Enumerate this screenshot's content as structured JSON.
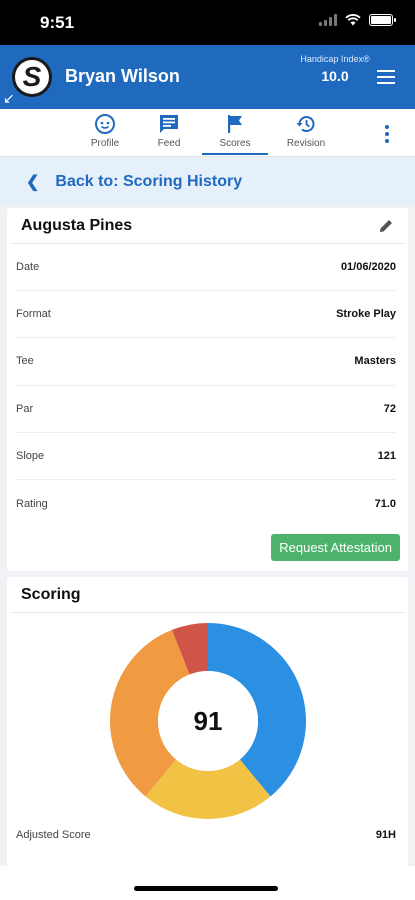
{
  "status": {
    "time": "9:51"
  },
  "header": {
    "user_name": "Bryan Wilson",
    "handicap_label": "Handicap Index®",
    "handicap_value": "10.0"
  },
  "tabs": [
    {
      "label": "Profile",
      "icon": "face-icon"
    },
    {
      "label": "Feed",
      "icon": "feed-icon"
    },
    {
      "label": "Scores",
      "icon": "flag-icon",
      "active": true
    },
    {
      "label": "Revision",
      "icon": "history-icon"
    }
  ],
  "back": {
    "label": "Back to: Scoring History"
  },
  "course": {
    "name": "Augusta Pines",
    "details": [
      {
        "label": "Date",
        "value": "01/06/2020"
      },
      {
        "label": "Format",
        "value": "Stroke Play"
      },
      {
        "label": "Tee",
        "value": "Masters"
      },
      {
        "label": "Par",
        "value": "72"
      },
      {
        "label": "Slope",
        "value": "121"
      },
      {
        "label": "Rating",
        "value": "71.0"
      }
    ],
    "attest_button": "Request Attestation"
  },
  "scoring": {
    "title": "Scoring",
    "total": "91",
    "segments": [
      {
        "color": "#2b8fe2",
        "fraction": 0.39
      },
      {
        "color": "#f2c245",
        "fraction": 0.22
      },
      {
        "color": "#f09a42",
        "fraction": 0.33
      },
      {
        "color": "#cf5548",
        "fraction": 0.06
      }
    ],
    "adjusted_label": "Adjusted Score",
    "adjusted_value": "91H"
  },
  "colors": {
    "brand": "#1f69bf",
    "attest": "#4cb46a"
  }
}
